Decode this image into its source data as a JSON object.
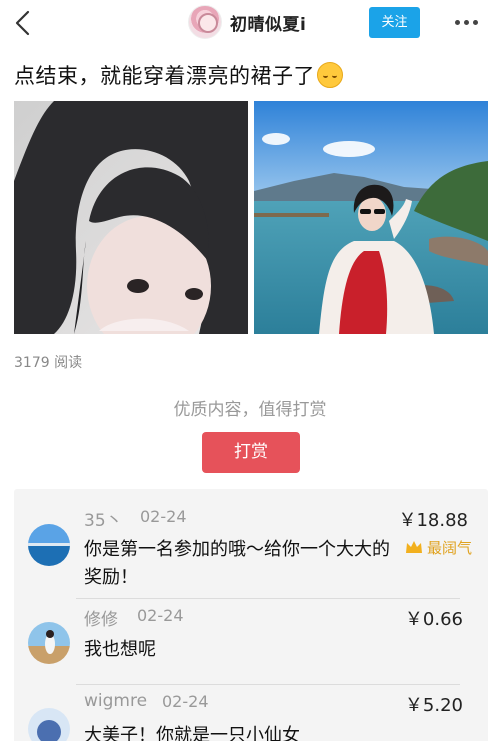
{
  "header": {
    "username": "初晴似夏i",
    "follow_label": "关注"
  },
  "post": {
    "text": "点结束，就能穿着漂亮的裙子了",
    "reads": "3179 阅读"
  },
  "tip": {
    "prompt": "优质内容，值得打赏",
    "button_label": "打赏"
  },
  "comments": [
    {
      "name": "35丶",
      "date": "02-24",
      "amount": "￥18.88",
      "text": "你是第一名参加的哦～给你一个大大的奖励！",
      "badge": "最阔气"
    },
    {
      "name": "修修",
      "date": "02-24",
      "amount": "￥0.66",
      "text": "我也想呢"
    },
    {
      "name": "wigmre",
      "date": "02-24",
      "amount": "￥5.20",
      "text": "大美子！你就是一只小仙女"
    }
  ],
  "colors": {
    "follow_blue": "#1ba3e8",
    "tip_red": "#e6525a",
    "badge_gold": "#e0a21f"
  }
}
